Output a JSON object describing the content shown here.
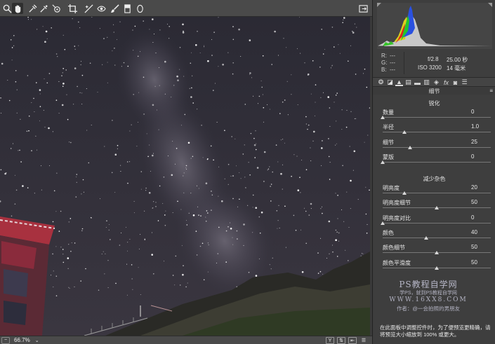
{
  "toolbar": {
    "tools": [
      "zoom-tool",
      "hand-tool",
      "white-balance-tool",
      "color-sampler-tool",
      "target-adjustment-tool",
      "crop-tool",
      "straighten-tool",
      "red-eye-tool",
      "adjustment-brush-tool",
      "graduated-filter-tool",
      "radial-filter-tool"
    ],
    "toggle_fullscreen": "fullscreen-icon"
  },
  "status": {
    "zoom_minus": "−",
    "zoom_plus": "+",
    "zoom_value": "66.7%",
    "zoom_dropdown": "⌄",
    "view_toggle_label": "Y"
  },
  "readout": {
    "r_label": "R:",
    "r_value": "---",
    "g_label": "G:",
    "g_value": "---",
    "b_label": "B:",
    "b_value": "---",
    "aperture": "f/2.8",
    "shutter": "25.00 秒",
    "iso": "ISO 3200",
    "focal": "14 毫米"
  },
  "panel": {
    "section_title": "细节",
    "sharpen": {
      "title": "锐化",
      "sliders": [
        {
          "label": "数量",
          "value": "0",
          "pos": 0.0
        },
        {
          "label": "半径",
          "value": "1.0",
          "pos": 0.2
        },
        {
          "label": "细节",
          "value": "25",
          "pos": 0.25
        },
        {
          "label": "蒙版",
          "value": "0",
          "pos": 0.0
        }
      ]
    },
    "noise": {
      "title": "减少杂色",
      "sliders": [
        {
          "label": "明亮度",
          "value": "20",
          "pos": 0.2
        },
        {
          "label": "明亮度细节",
          "value": "50",
          "pos": 0.5
        },
        {
          "label": "明亮度对比",
          "value": "0",
          "pos": 0.0
        },
        {
          "label": "颜色",
          "value": "40",
          "pos": 0.4
        },
        {
          "label": "颜色细节",
          "value": "50",
          "pos": 0.5
        },
        {
          "label": "颜色平滑度",
          "value": "50",
          "pos": 0.5
        }
      ]
    },
    "note": "在此面板中调整控件时，为了便预览更精确，请将预览大小缩放到 100% 或更大。"
  },
  "watermark": {
    "line1": "PS教程自学网",
    "line2": "学PS，就到PS教程自学网",
    "line3": "WWW.16XX8.COM",
    "line4": "作者：@一会拍照的男朋友"
  },
  "colors": {
    "panel_bg": "#3e3e3e",
    "toolbar_bg": "#4a4a4a",
    "sky": "#2c2b36",
    "roof_red": "#a8313f"
  }
}
